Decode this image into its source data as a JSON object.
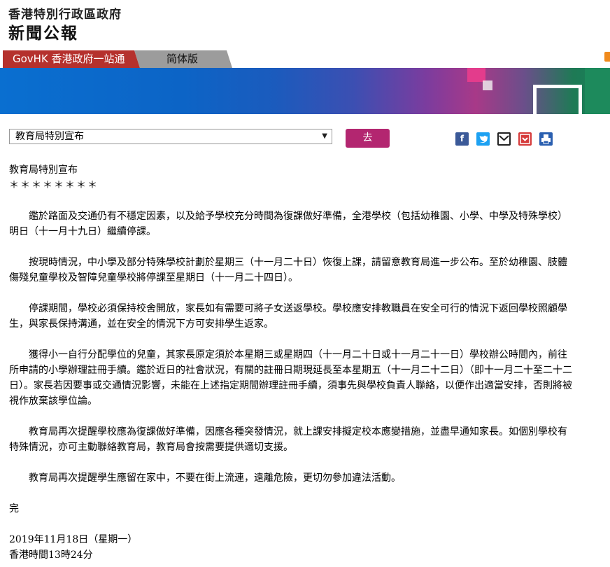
{
  "header": {
    "government": "香港特別行政區政府",
    "site": "新聞公報"
  },
  "tabs": {
    "govhk": "GovHK 香港政府一站通",
    "simplified": "简体版"
  },
  "colors": {
    "govhk_tab": "#b5312d",
    "go_button": "#b32670",
    "rss": "#f08a1c"
  },
  "selector": {
    "selected": "教育局特別宣布",
    "go_label": "去"
  },
  "share_icons": [
    "facebook-icon",
    "twitter-icon",
    "email-icon",
    "save-icon",
    "print-icon"
  ],
  "press": {
    "title": "教育局特別宣布",
    "stars": "＊＊＊＊＊＊＊＊",
    "p1": "鑑於路面及交通仍有不穩定因素，以及給予學校充分時間為復課做好準備，全港學校（包括幼稚園、小學、中學及特殊學校）明日（十一月十九日）繼續停課。",
    "p2": "按現時情況，中小學及部分特殊學校計劃於星期三（十一月二十日）恢復上課，請留意教育局進一步公布。至於幼稚園、肢體傷殘兒童學校及智障兒童學校將停課至星期日（十一月二十四日）。",
    "p3": "停課期間，學校必須保持校舍開放，家長如有需要可將子女送返學校。學校應安排教職員在安全可行的情況下返回學校照顧學生，與家長保持溝通，並在安全的情況下方可安排學生返家。",
    "p4": "獲得小一自行分配學位的兒童，其家長原定須於本星期三或星期四（十一月二十日或十一月二十一日）學校辦公時間內，前往所申請的小學辦理註冊手續。鑑於近日的社會狀況，有關的註冊日期現延長至本星期五（十一月二十二日）（即十一月二十至二十二日）。家長若因要事或交通情況影響，未能在上述指定期間辦理註冊手續，須事先與學校負責人聯絡，以便作出適當安排，否則將被視作放棄該學位論。",
    "p5": "教育局再次提醒學校應為復課做好準備，因應各種突發情況，就上課安排擬定校本應變措施，並盡早通知家長。如個別學校有特殊情況，亦可主動聯絡教育局，教育局會按需要提供適切支援。",
    "p6": "教育局再次提醒學生應留在家中，不要在街上流連，遠離危險，更切勿參加違法活動。",
    "end": "完",
    "date": "2019年11月18日（星期一）",
    "time": "香港時間13時24分"
  }
}
